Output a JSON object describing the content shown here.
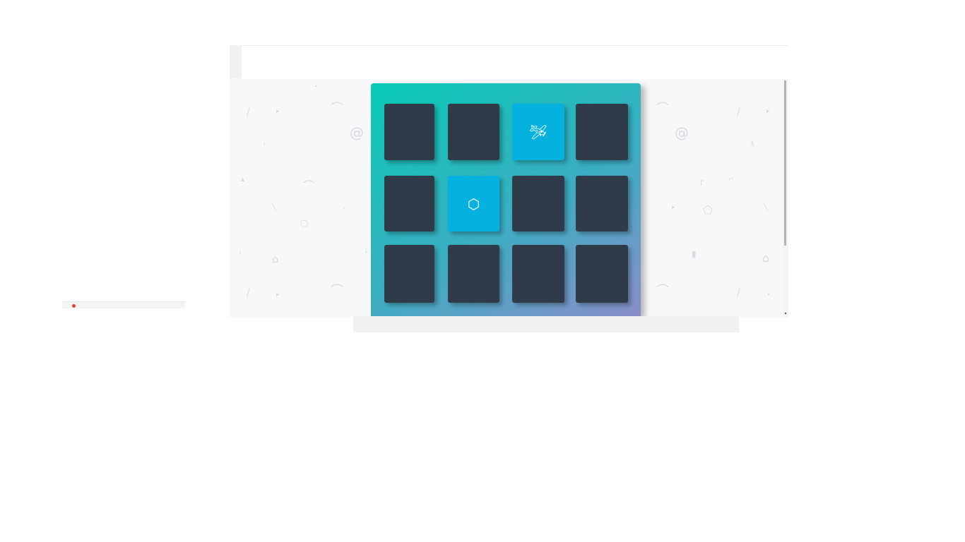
{
  "app": {
    "name": "memory-match-game",
    "board_gradient": [
      "#08cab5",
      "#3aaec2",
      "#8a8ec9"
    ],
    "card_back_color": "#2f3b49",
    "card_face_color": "#04b1df",
    "background_color": "#f7f8f9"
  },
  "header": {
    "peek_text": ""
  },
  "board": {
    "rows": 3,
    "columns": 4,
    "cards": [
      {
        "state": "hidden",
        "icon": ""
      },
      {
        "state": "hidden",
        "icon": ""
      },
      {
        "state": "flipped",
        "icon": "paper-plane-icon",
        "glyph": "🛩"
      },
      {
        "state": "hidden",
        "icon": ""
      },
      {
        "state": "hidden",
        "icon": ""
      },
      {
        "state": "flipped",
        "icon": "cube-icon",
        "glyph": "⬡"
      },
      {
        "state": "hidden",
        "icon": ""
      },
      {
        "state": "hidden",
        "icon": ""
      },
      {
        "state": "hidden",
        "icon": ""
      },
      {
        "state": "hidden",
        "icon": ""
      },
      {
        "state": "hidden",
        "icon": ""
      },
      {
        "state": "hidden",
        "icon": ""
      }
    ]
  },
  "taskbar": {
    "item_label": ""
  },
  "scrollbar": {
    "arrow": "▾"
  }
}
